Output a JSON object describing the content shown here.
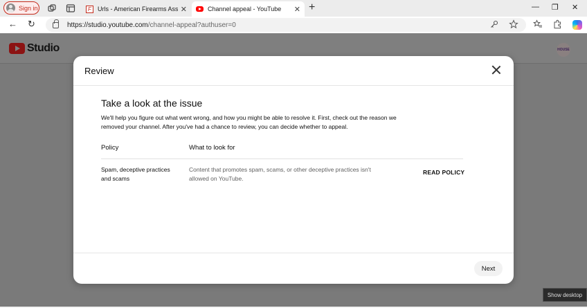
{
  "browser": {
    "signin_label": "Sign in",
    "tabs": [
      {
        "title": "Urls - American Firearms Associat",
        "active": false
      },
      {
        "title": "Channel appeal - YouTube",
        "active": true
      }
    ],
    "tab_close": "✕",
    "new_tab": "+",
    "window_controls": {
      "minimize": "—",
      "maximize": "❐",
      "close": "✕"
    },
    "url_host": "https://studio.youtube.com",
    "url_path": "/channel-appeal?authuser=0",
    "nav": {
      "back": "←",
      "reload": "↻"
    }
  },
  "studio": {
    "brand": "Studio",
    "avatar_text": "HOUSE"
  },
  "dialog": {
    "title": "Review",
    "heading": "Take a look at the issue",
    "description": "We'll help you figure out what went wrong, and how you might be able to resolve it. First, check out the reason we removed your channel. After you've had a chance to review, you can decide whether to appeal.",
    "columns": {
      "policy": "Policy",
      "what": "What to look for"
    },
    "rows": [
      {
        "policy": "Spam, deceptive practices and scams",
        "what": "Content that promotes spam, scams, or other deceptive practices isn't allowed on YouTube.",
        "action": "READ POLICY"
      }
    ],
    "next_label": "Next"
  },
  "taskbar": {
    "show_desktop": "Show desktop"
  }
}
